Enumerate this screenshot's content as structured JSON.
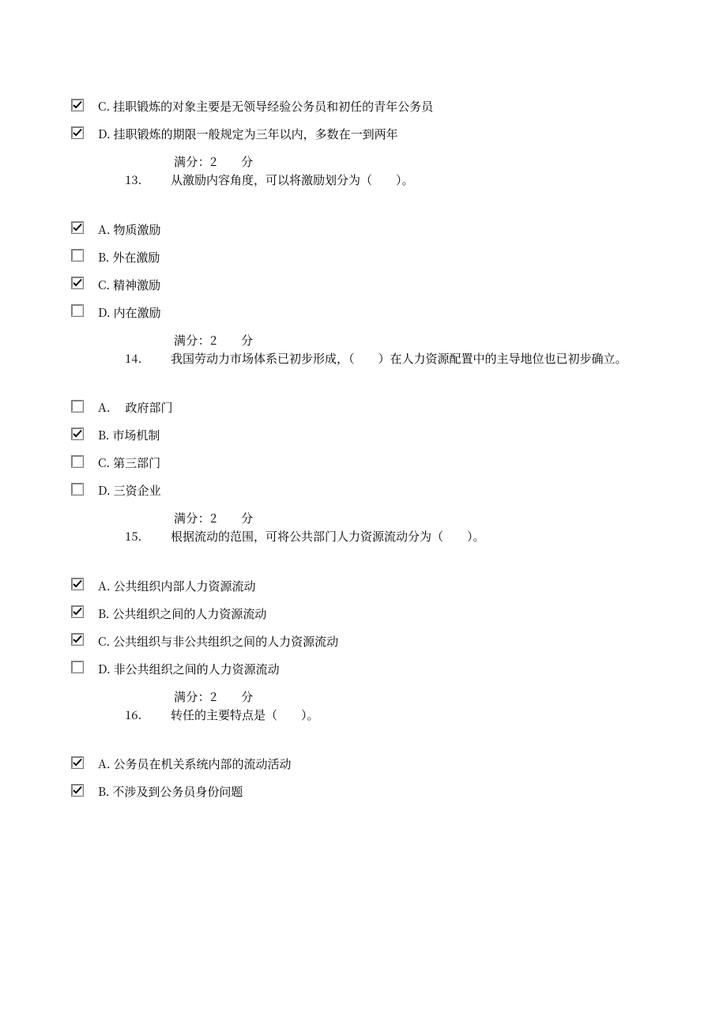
{
  "score_line": "满分：2　　分",
  "options_pre_q13": [
    {
      "letter": "C",
      "text": "挂职锻炼的对象主要是无领导经验公务员和初任的青年公务员",
      "checked": true
    },
    {
      "letter": "D",
      "text": "挂职锻炼的期限一般规定为三年以内，多数在一到两年",
      "checked": true
    }
  ],
  "questions": [
    {
      "num": "13.",
      "stem": "从激励内容角度，可以将激励划分为（　　）。",
      "options": [
        {
          "letter": "A",
          "text": "物质激励",
          "checked": true
        },
        {
          "letter": "B",
          "text": "外在激励",
          "checked": false
        },
        {
          "letter": "C",
          "text": "精神激励",
          "checked": true
        },
        {
          "letter": "D",
          "text": "内在激励",
          "checked": false
        }
      ]
    },
    {
      "num": "14.",
      "stem": "我国劳动力市场体系已初步形成，（　　）在人力资源配置中的主导地位也已初步确立。",
      "options": [
        {
          "letter": "A",
          "text": "　政府部门",
          "checked": false
        },
        {
          "letter": "B",
          "text": "市场机制",
          "checked": true
        },
        {
          "letter": "C",
          "text": "第三部门",
          "checked": false
        },
        {
          "letter": "D",
          "text": "三资企业",
          "checked": false
        }
      ]
    },
    {
      "num": "15.",
      "stem": "根据流动的范围，可将公共部门人力资源流动分为（　　）。",
      "options": [
        {
          "letter": "A",
          "text": "公共组织内部人力资源流动",
          "checked": true
        },
        {
          "letter": "B",
          "text": "公共组织之间的人力资源流动",
          "checked": true
        },
        {
          "letter": "C",
          "text": "公共组织与非公共组织之间的人力资源流动",
          "checked": true
        },
        {
          "letter": "D",
          "text": "非公共组织之间的人力资源流动",
          "checked": false
        }
      ]
    },
    {
      "num": "16.",
      "stem": "转任的主要特点是（　　）。",
      "options": [
        {
          "letter": "A",
          "text": "公务员在机关系统内部的流动活动",
          "checked": true
        },
        {
          "letter": "B",
          "text": "不涉及到公务员身份问题",
          "checked": true
        }
      ]
    }
  ]
}
